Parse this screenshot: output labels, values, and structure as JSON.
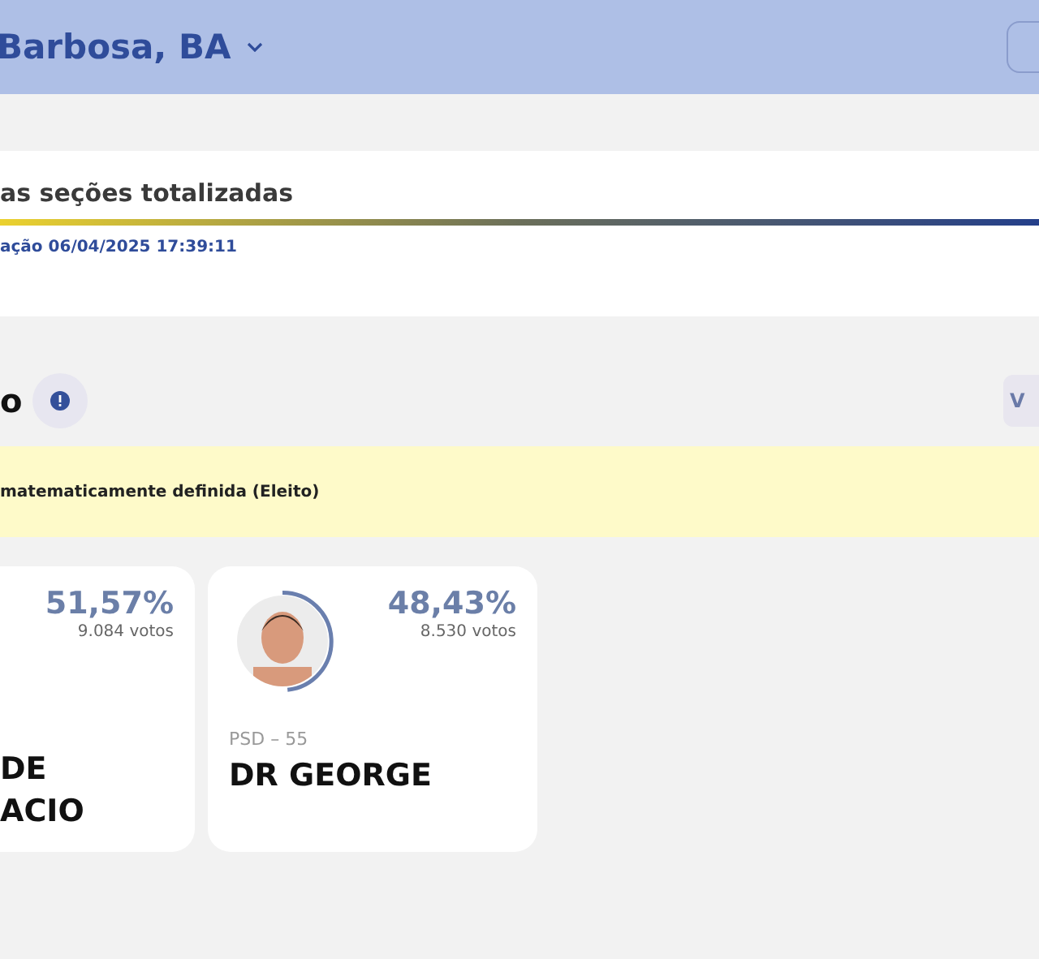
{
  "header": {
    "location": "Barbosa, BA"
  },
  "progress": {
    "title": "as seções totalizadas",
    "level": 1,
    "updated": "ação 06/04/2025 17:39:11"
  },
  "section": {
    "title": "o",
    "button": "V"
  },
  "notice": "matematicamente definida (Eleito)",
  "candidates": [
    {
      "name_lines": [
        "DE",
        "ACIO"
      ],
      "percent": "51,57%",
      "votes": "9.084 votos",
      "photo": false
    },
    {
      "party": "PSD – 55",
      "name_lines": [
        "DR GEORGE"
      ],
      "percent": "48,43%",
      "votes": "8.530 votos",
      "photo": true
    }
  ]
}
